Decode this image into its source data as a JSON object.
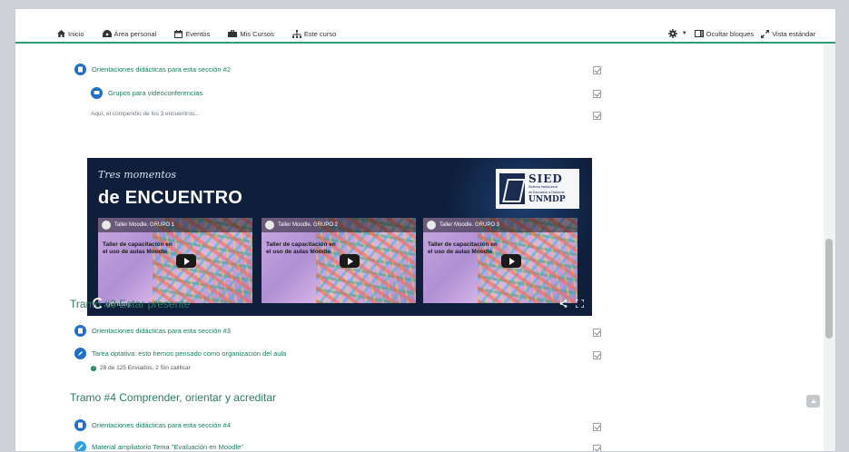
{
  "nav": {
    "items": [
      {
        "label": "Inicio",
        "icon": "home-icon"
      },
      {
        "label": "Área personal",
        "icon": "dashboard-icon"
      },
      {
        "label": "Eventos",
        "icon": "calendar-icon"
      },
      {
        "label": "Mis Cursos",
        "icon": "briefcase-icon"
      },
      {
        "label": "Este curso",
        "icon": "sitemap-icon"
      }
    ],
    "hide_blocks": "Ocultar bloques",
    "standard_view": "Vista estándar"
  },
  "activities": {
    "a1": "Orientaciones didácticas para esta sección #2",
    "a2": "Grupos para videoconferencias",
    "a3": "Orientaciones didácticas para esta sección #3",
    "a4": "Tarea optativa: esto hemos pensado como organización del aula",
    "a5": "Orientaciones didácticas para esta sección #4",
    "a6": "Material ampliatorio Tema \"Evaluación en Moodle\""
  },
  "summary_text": "Aquí, el compendio de los 3 encuentros...",
  "banner": {
    "script_title": "Tres momentos",
    "big_title": "de ENCUENTRO",
    "sied_title": "SIED",
    "sied_sub1": "Sistema Institucional",
    "sied_sub2": "de Educación a Distancia",
    "sied_unmdp": "UNMDP",
    "brand": "genially",
    "videos": [
      {
        "title": "Taller Moodle. GRUPO 1",
        "caption": "Taller de capacitación en el uso de aulas Moodle"
      },
      {
        "title": "Taller Moodle. GRUPO 2",
        "caption": "Taller de capacitación en el uso de aulas Moodle"
      },
      {
        "title": "Taller Moodle. GRUPO 3",
        "caption": "Taller de capacitación en el uso de aulas Moodle"
      }
    ]
  },
  "sections": {
    "s3": "Tramo #3 Estar presente",
    "s4": "Tramo #4 Comprender, orientar y acreditar"
  },
  "status_text": "28 de 125 Enviados, 2 Sin calificar",
  "colors": {
    "accent": "#2c9e77",
    "link": "#1a7d5f",
    "activity_icon": "#1f6fc5",
    "banner_bg": "#0f1e3a"
  }
}
